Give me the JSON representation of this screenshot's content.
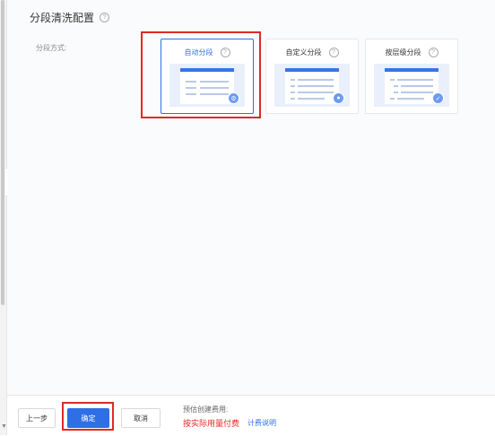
{
  "section": {
    "title": "分段清洗配置",
    "help": "?"
  },
  "field": {
    "label": "分段方式:"
  },
  "segmentation_modes": [
    {
      "label": "自动分段",
      "help": "?",
      "selected": true
    },
    {
      "label": "自定义分段",
      "help": "?",
      "selected": false
    },
    {
      "label": "按层级分段",
      "help": "?",
      "selected": false
    }
  ],
  "footer": {
    "prev_label": "上一步",
    "confirm_label": "确定",
    "cancel_label": "取消",
    "fee_label": "预估创建费用:",
    "fee_value": "按实际用量付费",
    "fee_link": "计费说明"
  },
  "colors": {
    "primary": "#2f6fe5",
    "highlight_box": "#e12828",
    "fee_text": "#e12828"
  }
}
